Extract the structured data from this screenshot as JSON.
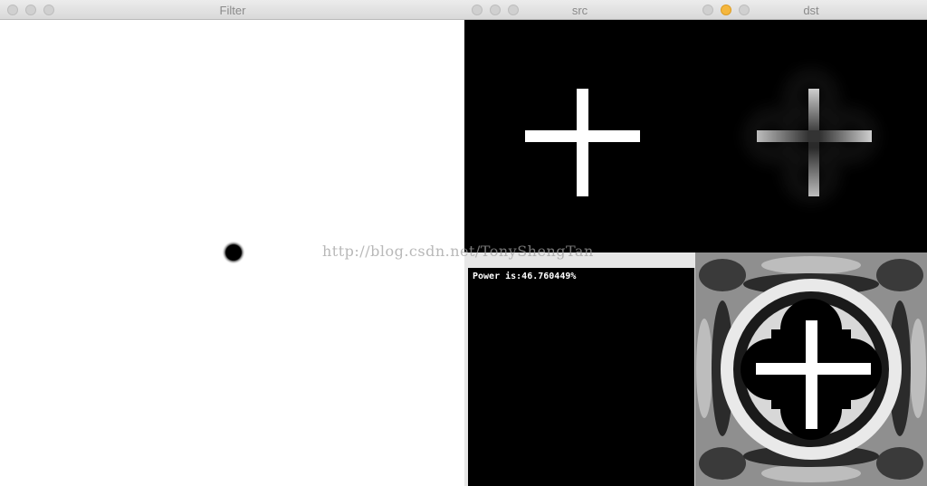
{
  "windows": {
    "filter": {
      "title": "Filter"
    },
    "src": {
      "title": "src"
    },
    "dst": {
      "title": "dst"
    }
  },
  "console": {
    "line": "Power is:46.760449%"
  },
  "watermark": "http://blog.csdn.net/TonyShengTan",
  "colors": {
    "titlebar": "#e2e2e2",
    "title_text": "#8a8a8a",
    "traffic_inactive": "#d0d0d0",
    "traffic_minimize_active": "#f5b73e",
    "image_bg": "#000000",
    "cross": "#ffffff"
  },
  "icons": {
    "close": "close-icon",
    "minimize": "minimize-icon",
    "zoom": "zoom-icon"
  }
}
